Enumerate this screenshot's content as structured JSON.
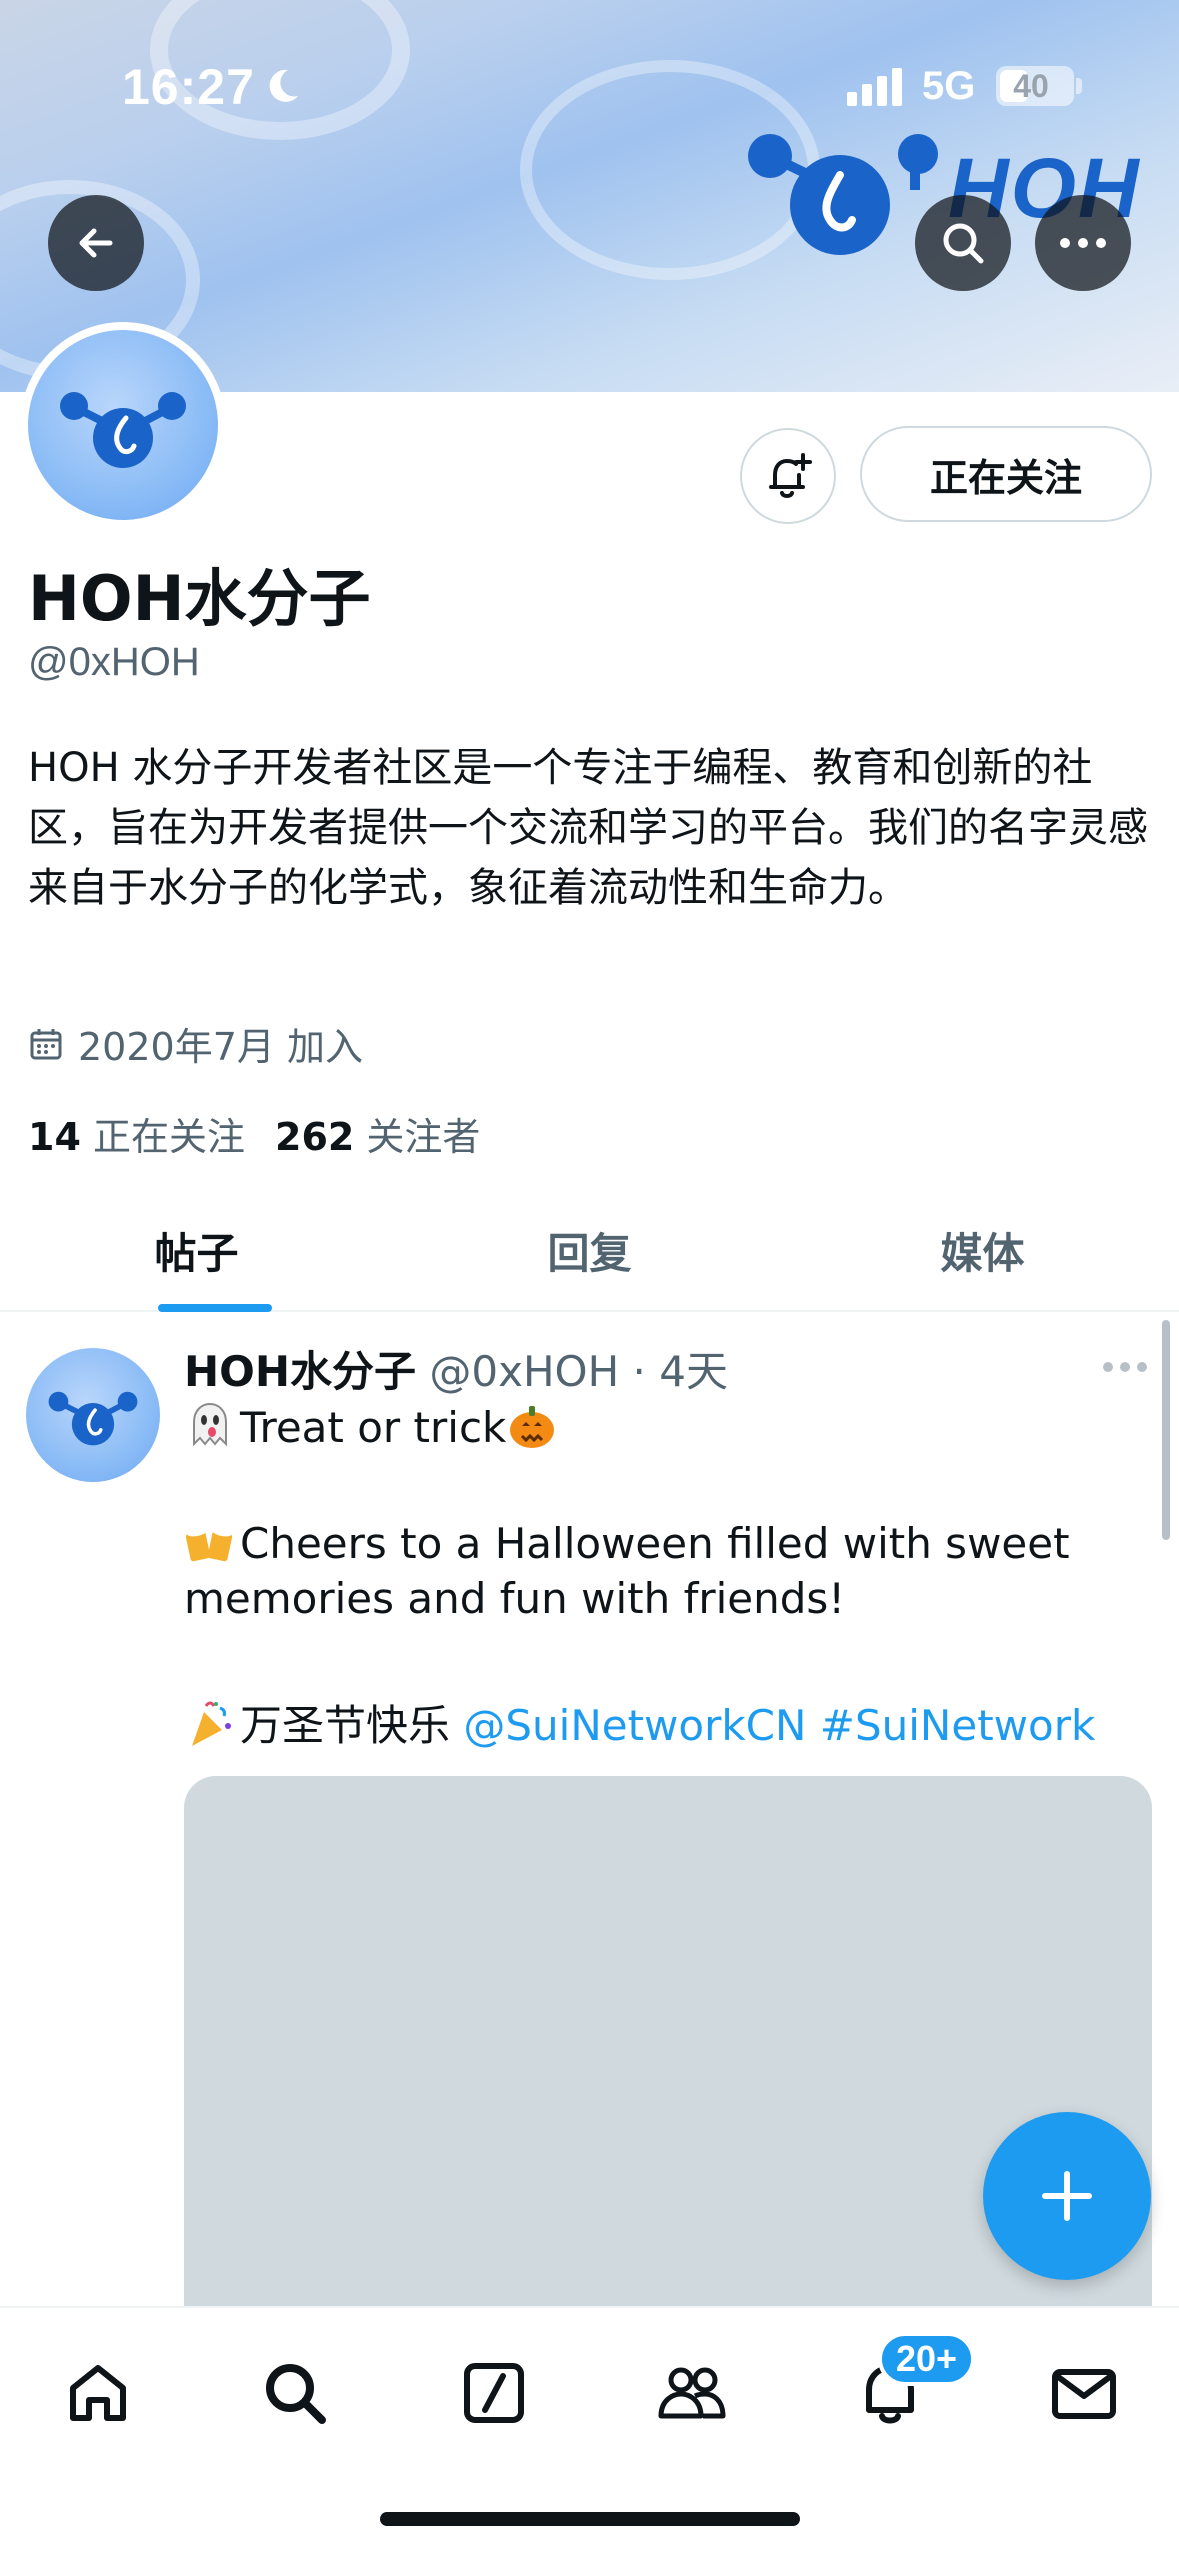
{
  "status_bar": {
    "time": "16:27",
    "network": "5G",
    "battery": "40",
    "battery_level": 0.4
  },
  "banner": {
    "logo_text": "HOH"
  },
  "profile": {
    "name": "HOH水分子",
    "handle": "@0xHOH",
    "bio": "HOH 水分子开发者社区是一个专注于编程、教育和创新的社区，旨在为开发者提供一个交流和学习的平台。我们的名字灵感来自于水分子的化学式，象征着流动性和生命力。",
    "joined": "2020年7月 加入",
    "following_count": "14",
    "following_label": "正在关注",
    "followers_count": "262",
    "followers_label": "关注者",
    "follow_button": "正在关注"
  },
  "tabs": [
    {
      "label": "帖子",
      "active": true
    },
    {
      "label": "回复",
      "active": false
    },
    {
      "label": "媒体",
      "active": false
    }
  ],
  "post": {
    "author": "HOH水分子",
    "meta": "@0xHOH · 4天",
    "line1": "Treat or trick",
    "line2": "Cheers to a Halloween filled with sweet",
    "line3": "memories and fun with friends!",
    "line4_text": "万圣节快乐",
    "mention": "@SuiNetworkCN",
    "hashtag": "#SuiNetwork"
  },
  "bottom_nav": {
    "items": [
      "home-icon",
      "search-icon",
      "grok-icon",
      "communities-icon",
      "notifications-icon",
      "messages-icon"
    ],
    "notifications_badge": "20+"
  },
  "colors": {
    "accent": "#1d9bf0",
    "text": "#0f1419",
    "secondary": "#536471",
    "logo_blue": "#1a63c9"
  }
}
